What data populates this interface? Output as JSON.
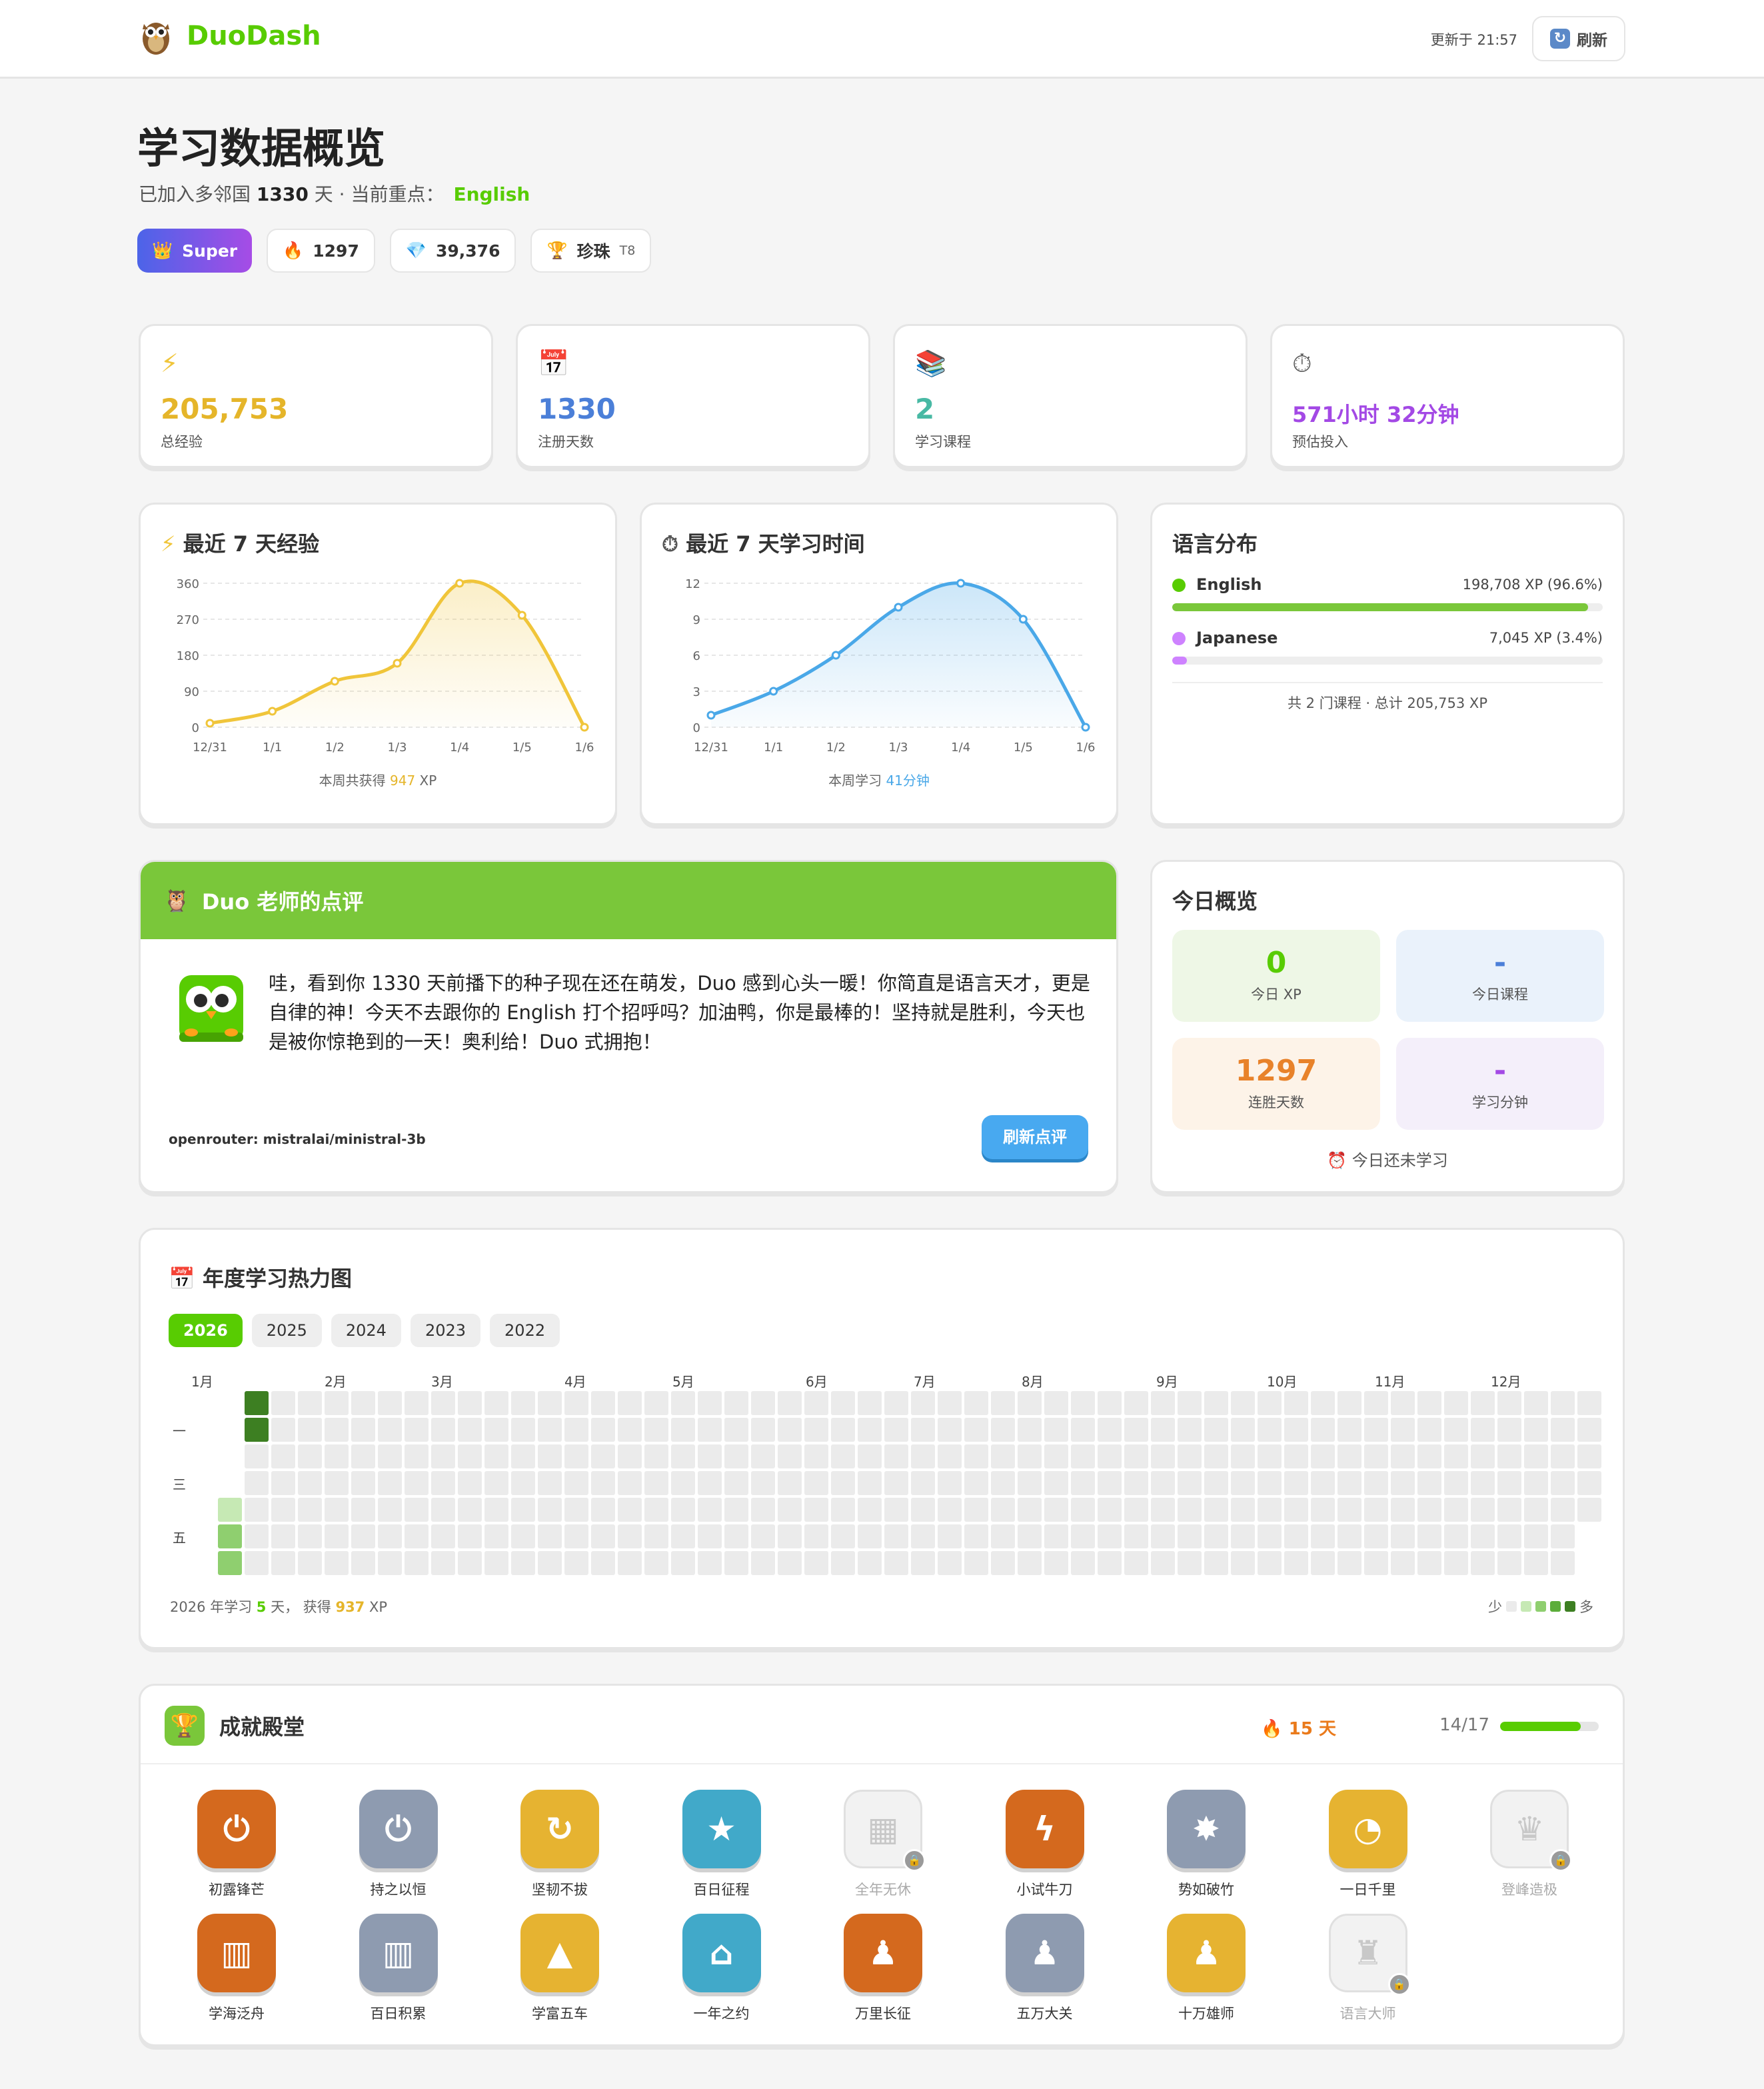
{
  "header": {
    "app_name": "DuoDash",
    "updated": "更新于 21:57",
    "refresh_label": "刷新"
  },
  "page": {
    "title": "学习数据概览",
    "joined_prefix": "已加入多邻国 ",
    "joined_days": "1330",
    "joined_suffix": " 天 · 当前重点：",
    "focus": "English"
  },
  "badges": {
    "super": "Super",
    "streak": "1297",
    "gems": "39,376",
    "league": "珍珠",
    "league_tier": "T8"
  },
  "stats": [
    {
      "icon": "⚡",
      "value": "205,753",
      "label": "总经验",
      "color": "#e5b52a"
    },
    {
      "icon": "📅",
      "value": "1330",
      "label": "注册天数",
      "color": "#4b7fd8"
    },
    {
      "icon": "📚",
      "value": "2",
      "label": "学习课程",
      "color": "#48b9a4"
    },
    {
      "icon": "⏱",
      "value": "571小时 32分钟",
      "label": "预估投入",
      "color": "#a349e5"
    }
  ],
  "xp_chart": {
    "title": "最近 7 天经验",
    "foot_prefix": "本周共获得 ",
    "foot_value": "947",
    "foot_suffix": " XP",
    "color": "#f0c53a",
    "chart_data": {
      "type": "area",
      "categories": [
        "12/31",
        "1/1",
        "1/2",
        "1/3",
        "1/4",
        "1/5",
        "1/6"
      ],
      "values": [
        10,
        40,
        115,
        160,
        360,
        280,
        0
      ],
      "ylim": [
        0,
        360
      ],
      "yticks": [
        0,
        90,
        180,
        270,
        360
      ],
      "grid": true
    }
  },
  "time_chart": {
    "title": "最近 7 天学习时间",
    "foot_prefix": "本周学习 ",
    "foot_value": "41分钟",
    "foot_suffix": "",
    "color": "#4aa8e8",
    "chart_data": {
      "type": "area",
      "categories": [
        "12/31",
        "1/1",
        "1/2",
        "1/3",
        "1/4",
        "1/5",
        "1/6"
      ],
      "values": [
        1,
        3,
        6,
        10,
        12,
        9,
        0
      ],
      "ylim": [
        0,
        12
      ],
      "yticks": [
        0,
        3,
        6,
        9,
        12
      ],
      "grid": true
    }
  },
  "languages": {
    "title": "语言分布",
    "items": [
      {
        "name": "English",
        "xp": "198,708 XP (96.6%)",
        "pct": 96.6,
        "color": "#58cc02"
      },
      {
        "name": "Japanese",
        "xp": "7,045 XP (3.4%)",
        "pct": 3.4,
        "color": "#ce82ff"
      }
    ],
    "foot": "共 2 门课程 · 总计 205,753 XP"
  },
  "review": {
    "title": "Duo 老师的点评",
    "text": "哇，看到你 1330 天前播下的种子现在还在萌发，Duo 感到心头一暖！你简直是语言天才，更是自律的神！今天不去跟你的 English 打个招呼吗？加油鸭，你是最棒的！坚持就是胜利，今天也是被你惊艳到的一天！奥利给！Duo 式拥抱！",
    "model": "openrouter: mistralai/ministral-3b",
    "button": "刷新点评"
  },
  "today": {
    "title": "今日概览",
    "tiles": [
      {
        "value": "0",
        "label": "今日 XP",
        "bg": "#eef7e6",
        "color": "#58cc02"
      },
      {
        "value": "-",
        "label": "今日课程",
        "bg": "#eaf2fb",
        "color": "#4b7fd8"
      },
      {
        "value": "1297",
        "label": "连胜天数",
        "bg": "#fdf3e8",
        "color": "#e8822a"
      },
      {
        "value": "-",
        "label": "学习分钟",
        "bg": "#f4effa",
        "color": "#a349e5"
      }
    ],
    "foot": "⏰ 今日还未学习"
  },
  "heatmap": {
    "title": "年度学习热力图",
    "years": [
      "2026",
      "2025",
      "2024",
      "2023",
      "2022"
    ],
    "active_year": "2026",
    "months": [
      "1月",
      "2月",
      "3月",
      "4月",
      "5月",
      "6月",
      "7月",
      "8月",
      "9月",
      "10月",
      "11月",
      "12月"
    ],
    "weekdays": [
      "一",
      "三",
      "五"
    ],
    "colors": [
      "#ebebeb",
      "#c6e9b4",
      "#8fcf6f",
      "#5cad3a",
      "#3d7f22"
    ],
    "active_cells": [
      {
        "week": 0,
        "day": 4,
        "level": 1
      },
      {
        "week": 0,
        "day": 5,
        "level": 2
      },
      {
        "week": 0,
        "day": 6,
        "level": 2
      },
      {
        "week": 1,
        "day": 0,
        "level": 4
      },
      {
        "week": 1,
        "day": 1,
        "level": 4
      }
    ],
    "foot_prefix": "2026 年学习 ",
    "foot_days": "5",
    "foot_mid": " 天， 获得 ",
    "foot_xp": "937",
    "foot_suffix": " XP",
    "legend_less": "少",
    "legend_more": "多"
  },
  "achievements": {
    "title": "成就殿堂",
    "streak": "15 天",
    "count": "14/17",
    "progress": 0.82,
    "items": [
      {
        "label": "初露锋芒",
        "icon": "⏻",
        "color": "#d4691e",
        "locked": false
      },
      {
        "label": "持之以恒",
        "icon": "⏻",
        "color": "#8e9bb0",
        "locked": false
      },
      {
        "label": "坚韧不拔",
        "icon": "↻",
        "color": "#e6b331",
        "locked": false
      },
      {
        "label": "百日征程",
        "icon": "★",
        "color": "#41a9c9",
        "locked": false
      },
      {
        "label": "全年无休",
        "icon": "▦",
        "color": "#f2f2f2",
        "locked": true
      },
      {
        "label": "小试牛刀",
        "icon": "ϟ",
        "color": "#d4691e",
        "locked": false
      },
      {
        "label": "势如破竹",
        "icon": "✸",
        "color": "#8e9bb0",
        "locked": false
      },
      {
        "label": "一日千里",
        "icon": "◔",
        "color": "#e6b331",
        "locked": false
      },
      {
        "label": "登峰造极",
        "icon": "♛",
        "color": "#f2f2f2",
        "locked": true
      },
      {
        "label": "学海泛舟",
        "icon": "▥",
        "color": "#d4691e",
        "locked": false
      },
      {
        "label": "百日积累",
        "icon": "▥",
        "color": "#8e9bb0",
        "locked": false
      },
      {
        "label": "学富五车",
        "icon": "▲",
        "color": "#e6b331",
        "locked": false
      },
      {
        "label": "一年之约",
        "icon": "⌂",
        "color": "#41a9c9",
        "locked": false
      },
      {
        "label": "万里长征",
        "icon": "♟",
        "color": "#d4691e",
        "locked": false
      },
      {
        "label": "五万大关",
        "icon": "♟",
        "color": "#8e9bb0",
        "locked": false
      },
      {
        "label": "十万雄师",
        "icon": "♟",
        "color": "#e6b331",
        "locked": false
      },
      {
        "label": "语言大师",
        "icon": "♜",
        "color": "#f2f2f2",
        "locked": true
      }
    ]
  }
}
